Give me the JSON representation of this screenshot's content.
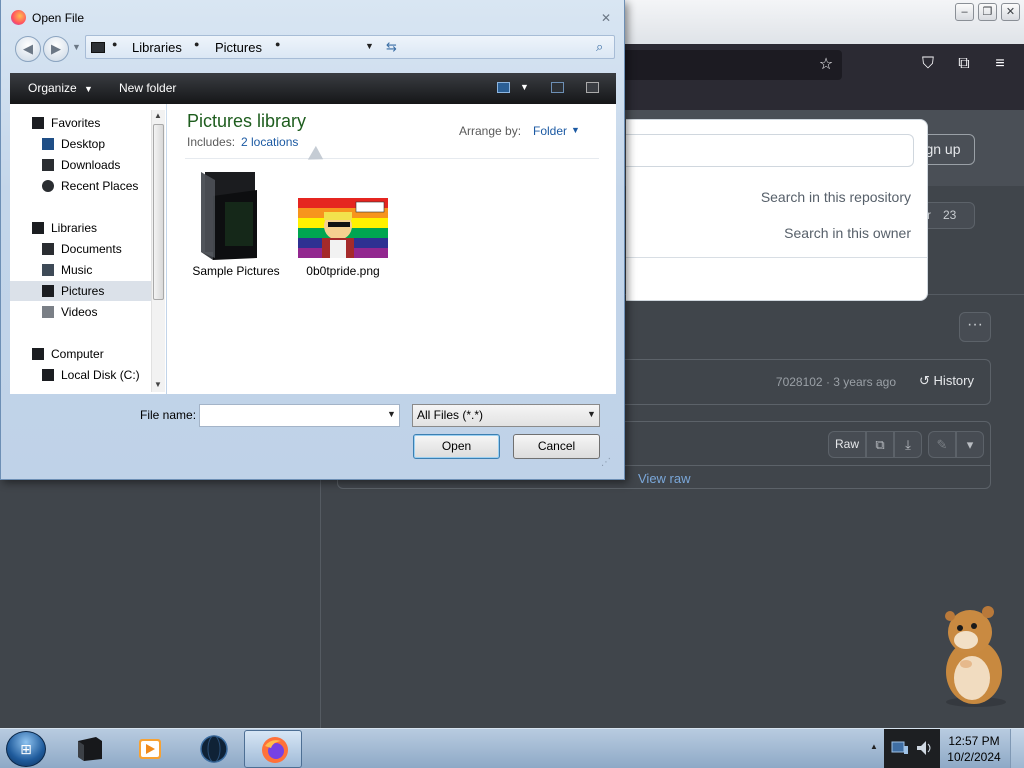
{
  "dialog": {
    "title": "Open File",
    "breadcrumb": [
      "Libraries",
      "Pictures"
    ],
    "toolbar": {
      "organize": "Organize",
      "new_folder": "New folder"
    },
    "nav": {
      "favorites": "Favorites",
      "desktop": "Desktop",
      "downloads": "Downloads",
      "recent_places": "Recent Places",
      "libraries": "Libraries",
      "documents": "Documents",
      "music": "Music",
      "pictures": "Pictures",
      "videos": "Videos",
      "computer": "Computer",
      "local_disk": "Local Disk (C:)"
    },
    "library": {
      "title": "Pictures library",
      "includes_label": "Includes:",
      "locations": "2 locations",
      "arrange_label": "Arrange by:",
      "arrange_value": "Folder"
    },
    "files": [
      {
        "name": "Sample Pictures",
        "icon": "folder-icon"
      },
      {
        "name": "0b0tpride.png",
        "icon": "image-thumbnail"
      }
    ],
    "filename_label": "File name:",
    "filename_value": "",
    "filetype": "All Files (*.*)",
    "open_button": "Open",
    "cancel_button": "Cancel"
  },
  "browser": {
    "signup": "Sign up",
    "star_count": "23",
    "search_suggestions": [
      "Search in this repository",
      "Search in this owner"
    ],
    "commit_hash": "7028102",
    "commit_age": "3 years ago",
    "history": "History",
    "raw_button": "Raw",
    "view_raw": "View raw"
  },
  "taskbar": {
    "time": "12:57 PM",
    "date": "10/2/2024",
    "apps": [
      "explorer",
      "media-player",
      "browser-globe",
      "firefox"
    ]
  },
  "colors": {
    "library_title": "#1e5d1e",
    "link_blue": "#1c5aa3",
    "toolbar_dark": "#1c1d20"
  }
}
